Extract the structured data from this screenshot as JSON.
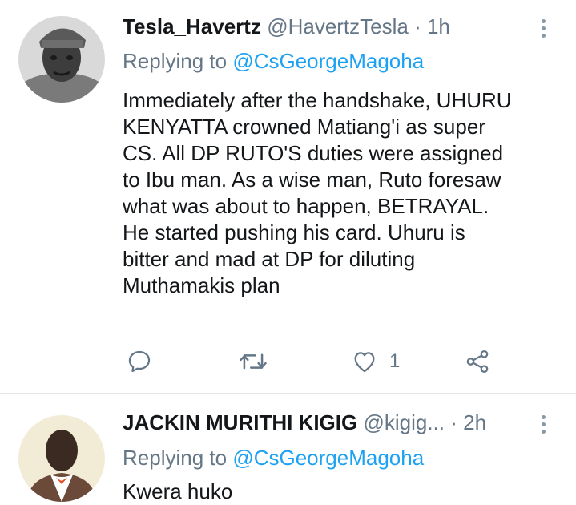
{
  "tweets": [
    {
      "display_name": "Tesla_Havertz",
      "handle": "@HavertzTesla",
      "separator": " · ",
      "time": "1h",
      "replying_prefix": "Replying to ",
      "replying_to": "@CsGeorgeMagoha",
      "lines": [
        "Immediately after the handshake, UHURU",
        "KENYATTA crowned Matiang'i as super",
        "CS. All DP RUTO'S duties were assigned",
        "to Ibu man. As a wise man, Ruto foresaw",
        "what was about to happen, BETRAYAL.",
        "He started pushing his card. Uhuru is",
        "bitter and mad at DP for diluting",
        "Muthamakis plan"
      ],
      "actions": {
        "reply_icon": "reply-icon",
        "retweet_icon": "retweet-icon",
        "like_icon": "heart-icon",
        "like_count": "1",
        "share_icon": "share-icon"
      }
    },
    {
      "display_name": "JACKIN MURITHI KIGIG",
      "handle": "@kigig...",
      "separator": " · ",
      "time": "2h",
      "replying_prefix": "Replying to ",
      "replying_to": "@CsGeorgeMagoha",
      "text": "Kwera huko"
    }
  ],
  "colors": {
    "text_primary": "#14171a",
    "text_secondary": "#657786",
    "link": "#1da1f2",
    "divider": "#e6e6e6"
  }
}
